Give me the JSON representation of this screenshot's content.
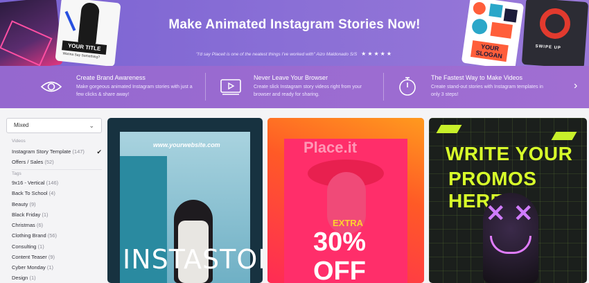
{
  "hero": {
    "title": "Make Animated Instagram Stories Now!",
    "quote": "\"I'd say Placeit is one of the neatest things I've worked with\"  Aizo Maldonado S/S",
    "stars": "★★★★★",
    "left_card_title": "YOUR TITLE",
    "left_card_subtitle": "Wanna Say Something?",
    "right_card_slogan": "YOUR SLOGAN",
    "right_card_swipe": "SWIPE UP"
  },
  "features": [
    {
      "title": "Create Brand Awareness",
      "desc": "Make gorgeous animated Instagram stories with just a few clicks & share away!",
      "icon": "eye-icon"
    },
    {
      "title": "Never Leave Your Browser",
      "desc": "Create slick Instagram story videos right from your browser and ready for sharing.",
      "icon": "video-player-icon"
    },
    {
      "title": "The Fastest Way to Make Videos",
      "desc": "Create stand-out stories with Instagram templates in only 3 steps!",
      "icon": "stopwatch-icon"
    }
  ],
  "next_arrow": "›",
  "sidebar": {
    "dropdown_value": "Mixed",
    "videos_label": "Videos",
    "videos": [
      {
        "label": "Instagram Story Template",
        "count": "(147)",
        "checked": true
      },
      {
        "label": "Offers / Sales",
        "count": "(52)"
      }
    ],
    "tags_label": "Tags",
    "tags": [
      {
        "label": "9x16 - Vertical",
        "count": "(146)"
      },
      {
        "label": "Back To School",
        "count": "(4)"
      },
      {
        "label": "Beauty",
        "count": "(9)"
      },
      {
        "label": "Black Friday",
        "count": "(1)"
      },
      {
        "label": "Christmas",
        "count": "(6)"
      },
      {
        "label": "Clothing Brand",
        "count": "(56)"
      },
      {
        "label": "Consulting",
        "count": "(1)"
      },
      {
        "label": "Content Teaser",
        "count": "(9)"
      },
      {
        "label": "Cyber Monday",
        "count": "(1)"
      },
      {
        "label": "Design",
        "count": "(1)"
      }
    ]
  },
  "cards": {
    "c1": {
      "url": "www.yourwebsite.com",
      "big": "INSTASTORY"
    },
    "c2": {
      "watermark": "Place.it",
      "extra": "EXTRA",
      "pct": "30%",
      "off": "OFF"
    },
    "c3": {
      "line1": "WRITE YOUR",
      "line2": "PROMOS HERE"
    }
  },
  "colors": {
    "hero_start": "#7a63d2",
    "hero_end": "#9a79d8",
    "card2": "#ff4a2e",
    "card3_accent": "#d8ff2a"
  }
}
